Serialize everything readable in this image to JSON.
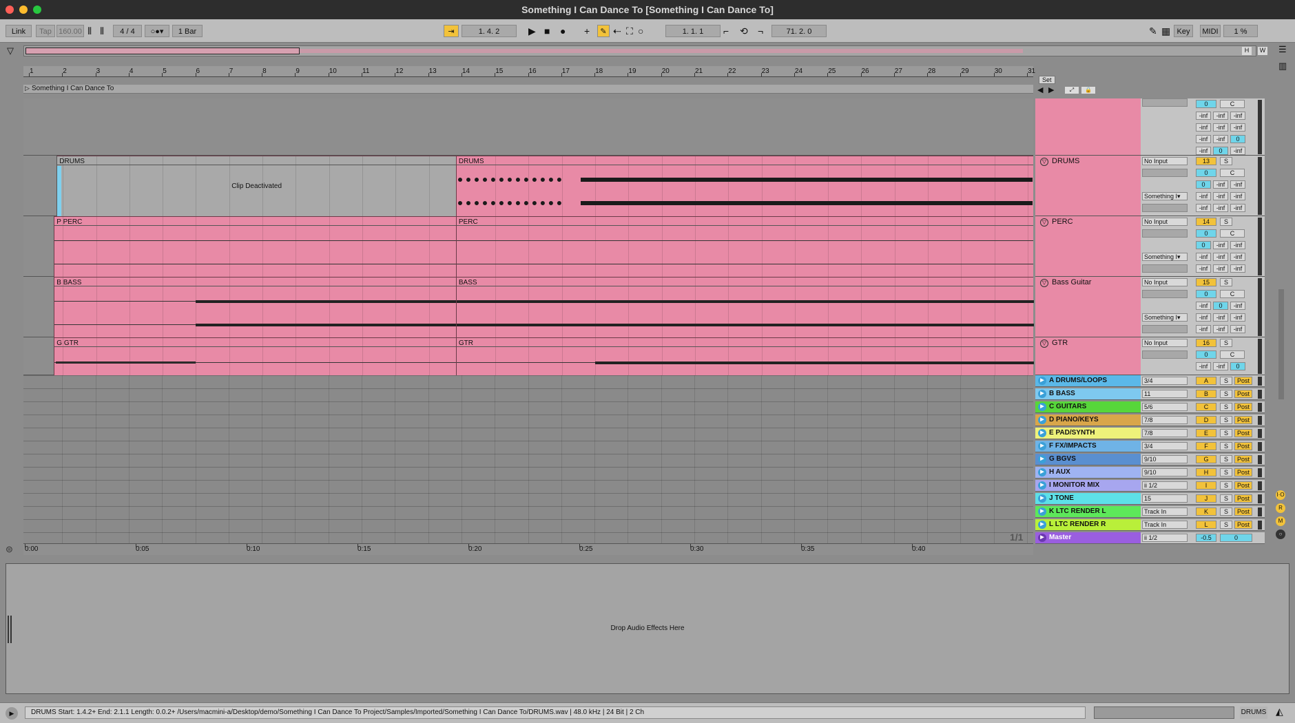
{
  "window": {
    "title": "Something I Can Dance To  [Something I Can Dance To]"
  },
  "control_bar": {
    "link": "Link",
    "tap": "Tap",
    "tempo": "160.00",
    "time_sig_num": "4",
    "time_sig_sep": "/",
    "time_sig_den": "4",
    "quantize": "1 Bar",
    "arrangement_position": "1.   4.   2",
    "punch_start": "1.   1.   1",
    "loop_length": "71.   2.   0",
    "key": "Key",
    "midi": "MIDI",
    "cpu": "1 %"
  },
  "overview": {
    "h_label": "H",
    "w_label": "W"
  },
  "ruler": {
    "bars": [
      "1",
      "2",
      "3",
      "4",
      "5",
      "6",
      "7",
      "8",
      "9",
      "10",
      "11",
      "12",
      "13",
      "14",
      "15",
      "16",
      "17",
      "18",
      "19",
      "20",
      "21",
      "22",
      "23",
      "24",
      "25",
      "26",
      "27",
      "28",
      "29",
      "30",
      "31"
    ],
    "set_label": "Set"
  },
  "song": {
    "name": "Something I Can Dance To"
  },
  "tracks": [
    {
      "id": "drums",
      "name": "DRUMS",
      "input": "No Input",
      "number": "13",
      "solo": "S",
      "vol": "0",
      "pan": "C",
      "sends": [
        "0",
        "-inf",
        "-inf"
      ],
      "out": "Something I▾",
      "meters": [
        "-inf",
        "-inf",
        "-inf"
      ],
      "clips": [
        {
          "name": "DRUMS",
          "deactivated": true,
          "label": "Clip Deactivated"
        },
        {
          "name": "DRUMS"
        }
      ]
    },
    {
      "id": "perc",
      "name": "PERC",
      "input": "No Input",
      "number": "14",
      "solo": "S",
      "vol": "0",
      "pan": "C",
      "sends": [
        "0",
        "-inf",
        "-inf"
      ],
      "out": "Something I▾",
      "meters": [
        "-inf",
        "-inf",
        "-inf"
      ],
      "clips": [
        {
          "name": "PERC",
          "prefix": "P"
        },
        {
          "name": "PERC"
        }
      ]
    },
    {
      "id": "bass",
      "name": "Bass Guitar",
      "input": "No Input",
      "number": "15",
      "solo": "S",
      "vol": "0",
      "pan": "C",
      "sends": [
        "-inf",
        "0",
        "-inf"
      ],
      "out": "Something I▾",
      "meters": [
        "-inf",
        "-inf",
        "-inf"
      ],
      "clips": [
        {
          "name": "BASS",
          "prefix": "B"
        },
        {
          "name": "BASS"
        }
      ]
    },
    {
      "id": "gtr",
      "name": "GTR",
      "input": "No Input",
      "number": "16",
      "solo": "S",
      "vol": "0",
      "pan": "C",
      "sends": [
        "-inf",
        "-inf",
        "0"
      ],
      "clips": [
        {
          "name": "GTR",
          "prefix": "G"
        },
        {
          "name": "GTR"
        }
      ]
    }
  ],
  "top_track": {
    "rows": [
      [
        "0",
        "C"
      ],
      [
        "-inf",
        "-inf",
        "-inf"
      ],
      [
        "-inf",
        "-inf",
        "-inf"
      ],
      [
        "-inf",
        "-inf",
        "0"
      ],
      [
        "-inf",
        "0",
        "-inf"
      ]
    ]
  },
  "returns": [
    {
      "name": "A DRUMS/LOOPS",
      "io": "3/4",
      "letter": "A",
      "color": "#5bb8e8"
    },
    {
      "name": "B BASS",
      "io": "11",
      "letter": "B",
      "color": "#7ec9ef"
    },
    {
      "name": "C GUITARS",
      "io": "5/6",
      "letter": "C",
      "color": "#57d63a"
    },
    {
      "name": "D PIANO/KEYS",
      "io": "7/8",
      "letter": "D",
      "color": "#d9a64a"
    },
    {
      "name": "E PAD/SYNTH",
      "io": "7/8",
      "letter": "E",
      "color": "#eef27a"
    },
    {
      "name": "F FX/IMPACTS",
      "io": "3/4",
      "letter": "F",
      "color": "#6fb3e6"
    },
    {
      "name": "G BGVS",
      "io": "9/10",
      "letter": "G",
      "color": "#5a8fd0"
    },
    {
      "name": "H AUX",
      "io": "9/10",
      "letter": "H",
      "color": "#9fb3f2"
    },
    {
      "name": "I MONITOR MIX",
      "io": "ii 1/2",
      "letter": "I",
      "color": "#a7a6ef"
    },
    {
      "name": "J TONE",
      "io": "15",
      "letter": "J",
      "color": "#5de0e8"
    },
    {
      "name": "K LTC RENDER L",
      "io": "Track In",
      "letter": "K",
      "color": "#5de85a"
    },
    {
      "name": "L LTC RENDER R",
      "io": "Track In",
      "letter": "L",
      "color": "#b9ef3a"
    }
  ],
  "master": {
    "name": "Master",
    "io": "ii 1/2",
    "vol": "-0.5",
    "pan": "0",
    "color": "#9a5ee0"
  },
  "return_controls": {
    "solo": "S",
    "post": "Post"
  },
  "timeline": {
    "labels": [
      "0:00",
      "0:05",
      "0:10",
      "0:15",
      "0:20",
      "0:25",
      "0:30",
      "0:35",
      "0:40"
    ],
    "zoom": "1/1"
  },
  "device": {
    "drop_text": "Drop Audio Effects Here"
  },
  "status": {
    "text": "DRUMS Start: 1.4.2+ End: 2.1.1 Length: 0.0.2+ /Users/macmini-a/Desktop/demo/Something I Can Dance To Project/Samples/Imported/Something I Can Dance To/DRUMS.wav | 48.0 kHz | 24 Bit | 2 Ch",
    "track": "DRUMS"
  }
}
